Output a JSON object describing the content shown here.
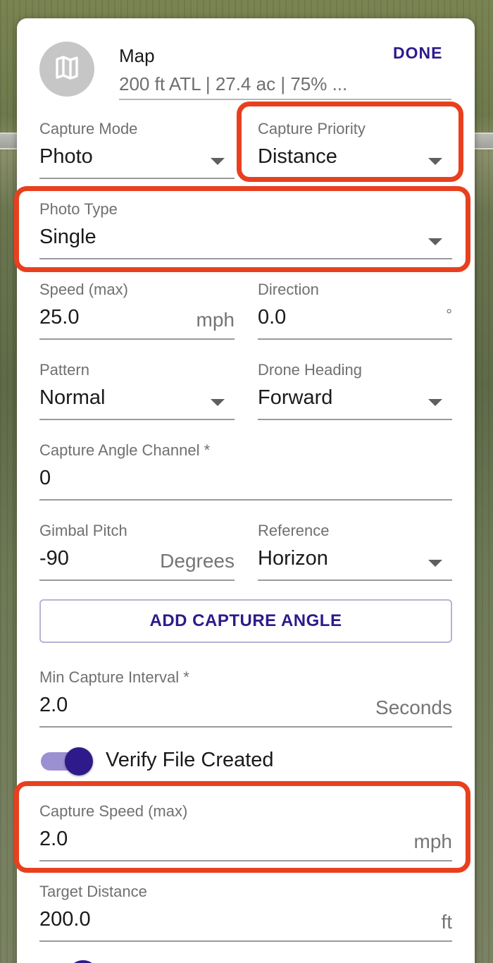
{
  "header": {
    "title": "Map",
    "subtitle": "200 ft ATL | 27.4 ac | 75% ...",
    "done_label": "DONE",
    "icon": "map-icon"
  },
  "fields": {
    "capture_mode": {
      "label": "Capture Mode",
      "value": "Photo"
    },
    "capture_priority": {
      "label": "Capture Priority",
      "value": "Distance"
    },
    "photo_type": {
      "label": "Photo Type",
      "value": "Single"
    },
    "speed_max": {
      "label": "Speed (max)",
      "value": "25.0",
      "unit": "mph"
    },
    "direction": {
      "label": "Direction",
      "value": "0.0",
      "unit": "°"
    },
    "pattern": {
      "label": "Pattern",
      "value": "Normal"
    },
    "drone_heading": {
      "label": "Drone Heading",
      "value": "Forward"
    },
    "capture_angle_channel": {
      "label": "Capture Angle Channel *",
      "value": "0"
    },
    "gimbal_pitch": {
      "label": "Gimbal Pitch",
      "value": "-90",
      "unit": "Degrees"
    },
    "reference": {
      "label": "Reference",
      "value": "Horizon"
    },
    "min_capture_interval": {
      "label": "Min Capture Interval *",
      "value": "2.0",
      "unit": "Seconds"
    },
    "capture_speed_max": {
      "label": "Capture Speed (max)",
      "value": "2.0",
      "unit": "mph"
    },
    "target_distance": {
      "label": "Target Distance",
      "value": "200.0",
      "unit": "ft"
    }
  },
  "add_capture_angle_label": "ADD CAPTURE ANGLE",
  "verify_file": {
    "label": "Verify File Created",
    "checked": true
  },
  "colors": {
    "accent": "#2e1a8a",
    "toggle_track": "#9b90d2",
    "highlight": "#e8401f"
  }
}
